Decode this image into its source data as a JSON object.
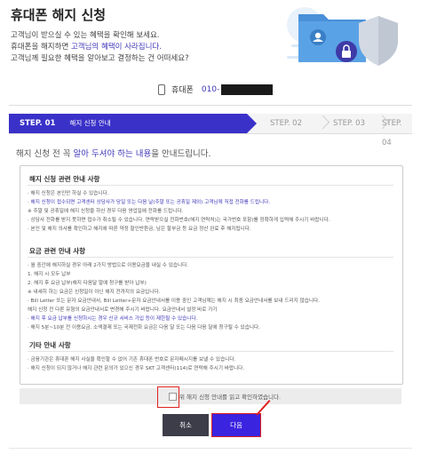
{
  "header": {
    "title": "휴대폰 해지 신청",
    "intro_line1": "고객님이 받으실 수 있는 혜택을 확인해 보세요.",
    "intro_line2_pre": "휴대폰을 해지하면 ",
    "intro_line2_hl": "고객님의 혜택이 사라집니다.",
    "intro_line3": "고객님께 필요한 혜택을 알아보고 결정하는 건 어떠세요?"
  },
  "phone": {
    "label": "휴대폰",
    "number_prefix": "010-"
  },
  "steps": [
    {
      "label": "STEP. 01",
      "sub": "해지 신청 안내"
    },
    {
      "label": "STEP. 02"
    },
    {
      "label": "STEP. 03"
    },
    {
      "label": "STEP. 04"
    }
  ],
  "notice": {
    "pre": "해지 신청 전 꼭 ",
    "hl": "알아 두셔야 하는 내용",
    "post": "을 안내드립니다."
  },
  "sections": {
    "s1": {
      "title": "해지 신청 관련 안내 사항",
      "lines": [
        "· 해지 신청은 본인만 하실 수 있습니다.",
        "· 해지 신청이 접수되면 고객센터 상담사가 당일 또는 다음 날(주말 또는 공휴일 제외) 고객님께 직접 전화를 드립니다.",
        "  ※ 주말 및 공휴일에 해지 신청을 하신 경우 다음 영업일에 전화를 드립니다.",
        "· 상담사 전화를 받지 못하면 접수가 취소될 수 있습니다. 연락받으실 전화번호(해지 연락처)는 국가번호 포함)를 정확하게 입력해 주시기 바랍니다.",
        "· 본인 및 해지 의사를 확인하고 해지에 따른 약정 할인반환금, 남은 할부금 등 요금 정산 완료 후 해지됩니다."
      ]
    },
    "s2": {
      "title": "요금 관련 안내 사항",
      "lines": [
        "· 월 중간에 해지하실 경우 아래 2가지 방법으로 이용요금을 내실 수 있습니다.",
        "  1. 해지 시 모두 납부",
        "  2. 해지 후 요금 납부(해지 다음달 말에 청구를 받아 납부)",
        "  ※ 내세히 하는 요금은 신청일이 아닌 해지 전까지의 요금입니다.",
        "· Bill Letter 또는 문자 요금안내서, Bill Letter+문자 요금안내서를 이용 중인 고객님께는 해지 시 최종 요금안내서를 보내 드리지 않습니다.",
        "  해지 신청 전 다른 유형의 요금안내서로 변경해 주시기 바랍니다. 요금안내서 설정 바로 가기",
        "· 해지 후 요금 납부를 신청하시는 경우 신규 서비스 가입 등이 제한될 수 있습니다.",
        "· 해지 5분~10분 전 이용요금, 소액결제 또는 국제전화 요금은 다음 달 또는 다음 다음 달에 청구될 수 있습니다."
      ]
    },
    "s3": {
      "title": "기타 안내 사항",
      "lines": [
        "· 금융기관은 휴대폰 해지 사실을 확인할 수 없어 기존 휴대폰 번호로 문자메시지를 보낼 수 있습니다.",
        "· 해지 신청이 되지 않거나 해지 관련 문의가 있으신 경우 SKT 고객센터(114)로 연락해 주시기 바랍니다."
      ]
    }
  },
  "agree": {
    "label": "위 해지 신청 안내를 읽고 확인하였습니다."
  },
  "buttons": {
    "cancel": "취소",
    "next": "다음"
  },
  "colors": {
    "accent": "#3a31c9",
    "highlight": "#3f37b8",
    "annotation": "#e02020"
  }
}
